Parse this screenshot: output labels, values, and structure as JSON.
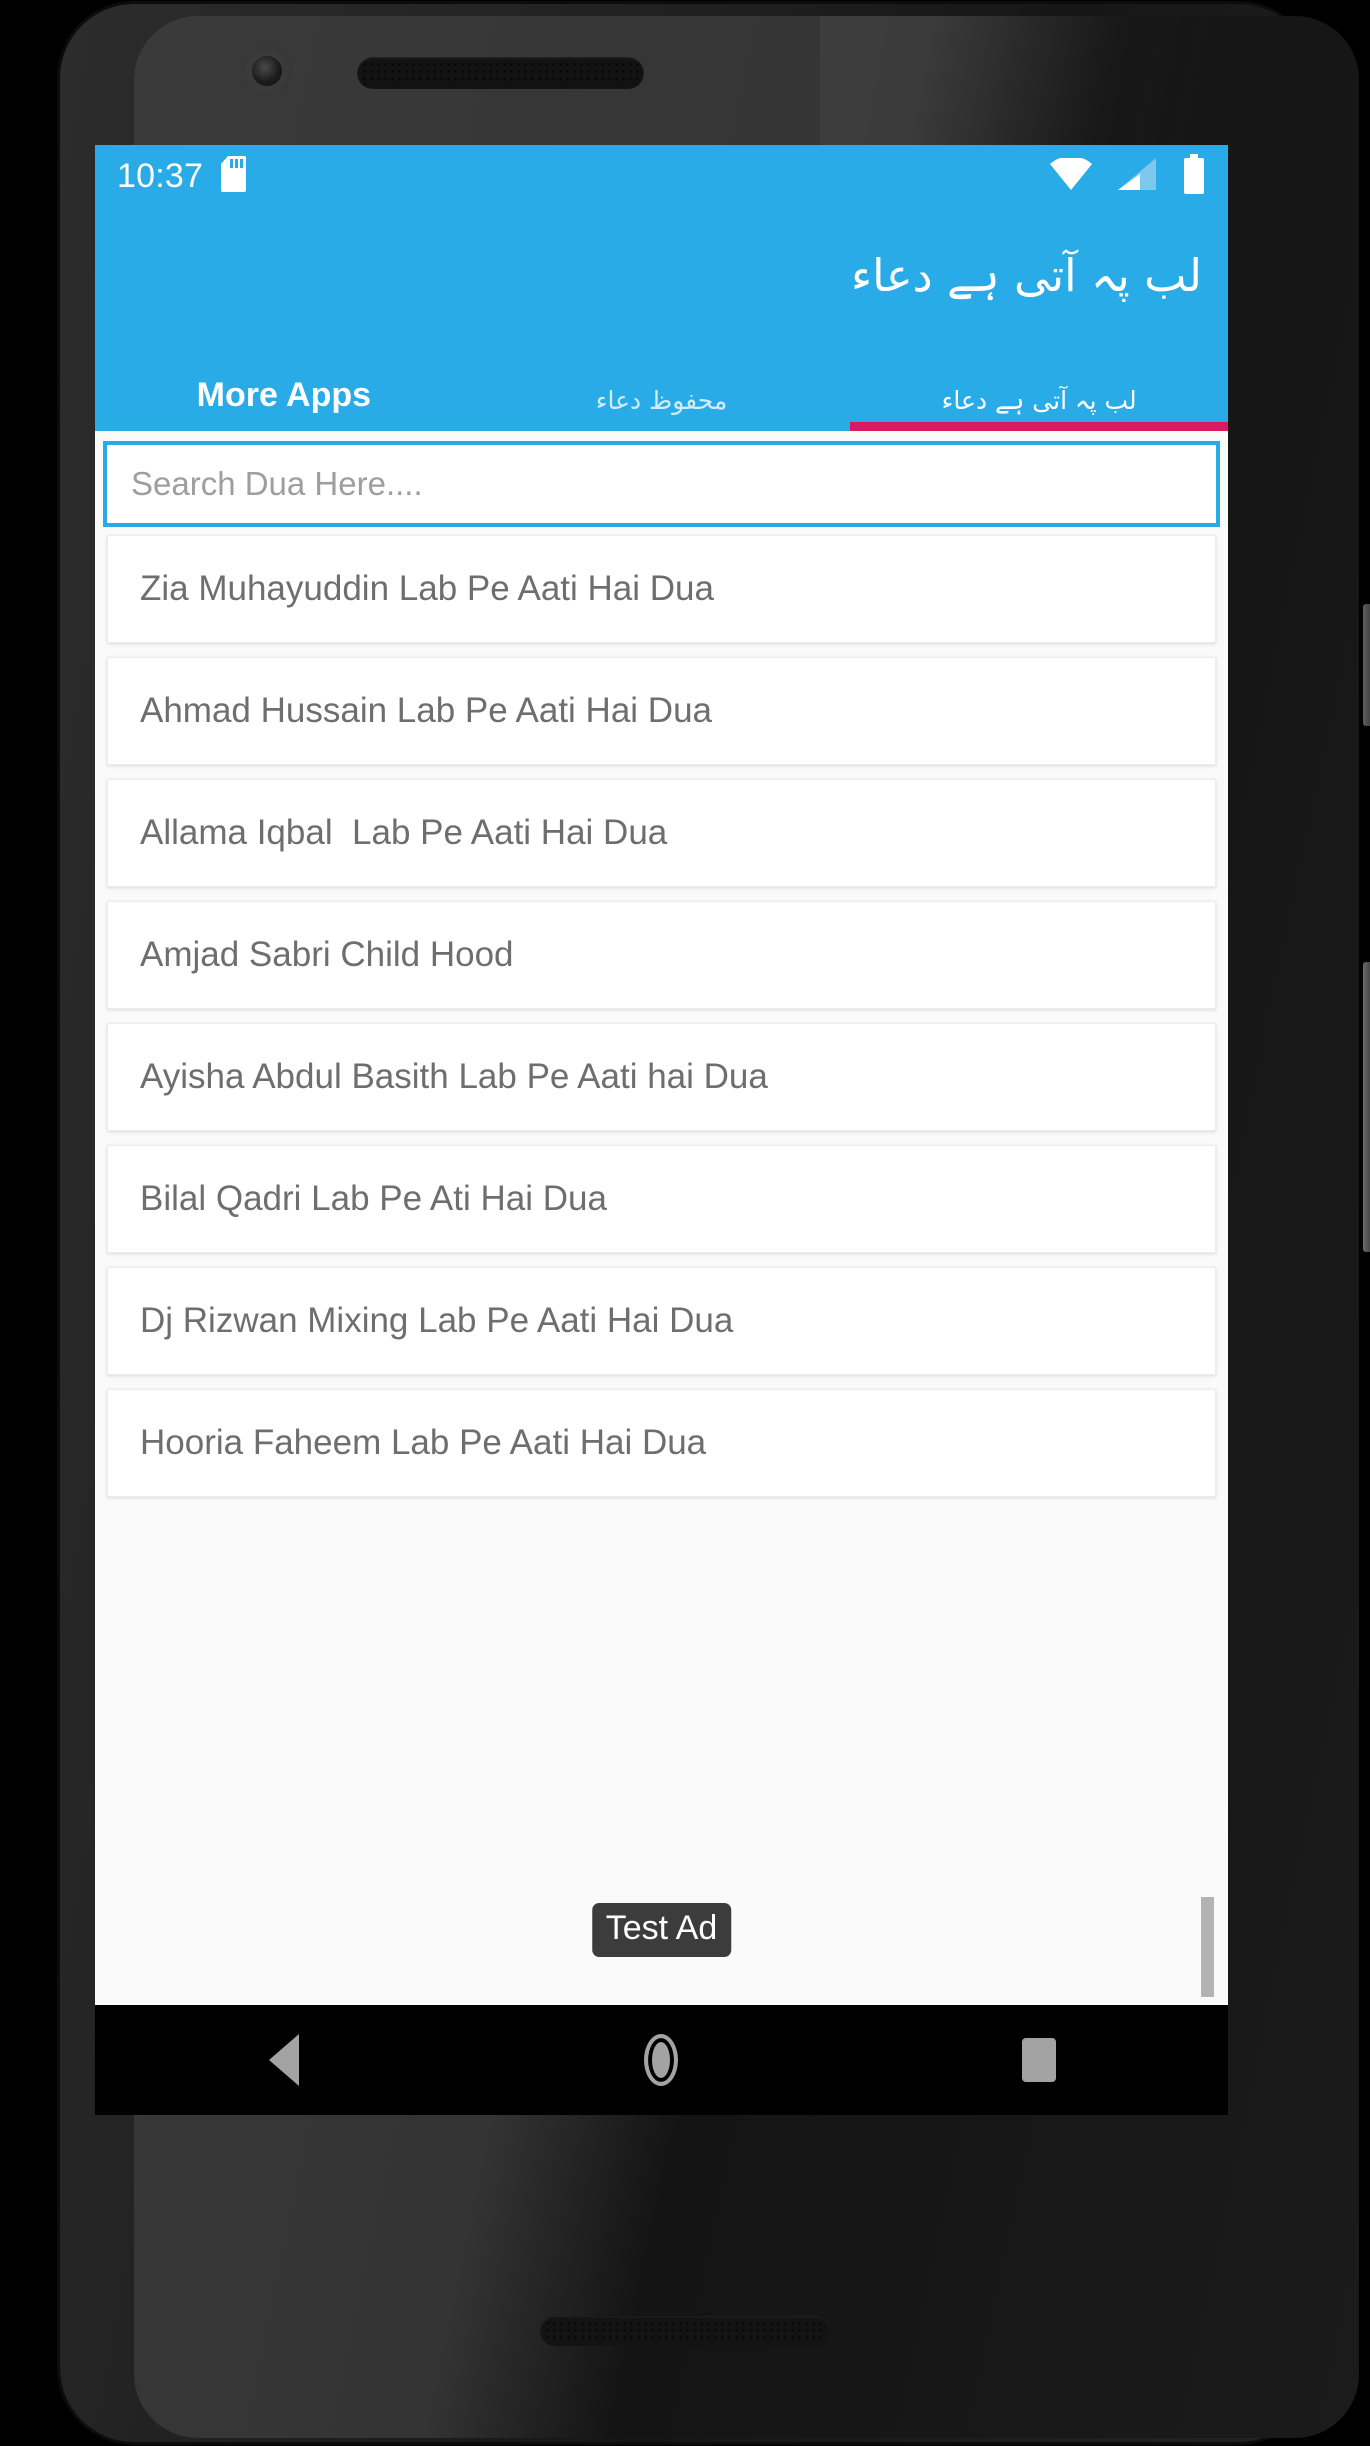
{
  "status_bar": {
    "time": "10:37",
    "icons": [
      "sd-card-icon",
      "wifi-icon",
      "signal-icon",
      "battery-icon"
    ]
  },
  "app_bar": {
    "title": "لب پہ آتی ہے دعاء"
  },
  "tabs": [
    {
      "label": "More Apps",
      "active": false,
      "script": "latin"
    },
    {
      "label": "محفوظ دعاء",
      "active": false,
      "script": "urdu"
    },
    {
      "label": "لب پہ آتی ہے دعاء",
      "active": true,
      "script": "urdu"
    }
  ],
  "search": {
    "placeholder": "Search Dua Here....",
    "value": ""
  },
  "dua_list": [
    {
      "title": "Zia Muhayuddin Lab Pe Aati Hai Dua"
    },
    {
      "title": "Ahmad Hussain Lab Pe Aati Hai Dua"
    },
    {
      "title": "Allama Iqbal  Lab Pe Aati Hai Dua"
    },
    {
      "title": "Amjad Sabri Child Hood"
    },
    {
      "title": "Ayisha Abdul Basith Lab Pe Aati hai Dua"
    },
    {
      "title": "Bilal Qadri Lab Pe Ati Hai Dua"
    },
    {
      "title": "Dj Rizwan Mixing Lab Pe Aati Hai Dua"
    },
    {
      "title": "Hooria Faheem Lab Pe Aati Hai Dua"
    }
  ],
  "ad": {
    "label": "Test Ad"
  },
  "nav_bar": {
    "back": "back-icon",
    "home": "home-icon",
    "recents": "recents-icon"
  },
  "colors": {
    "accent_blue": "#29ABE8",
    "tab_indicator": "#D81B60",
    "card_bg": "#FFFFFF",
    "page_bg": "#FAFAFA",
    "text_gray": "#6E6E6E",
    "ad_badge_bg": "#3C3C3C"
  }
}
